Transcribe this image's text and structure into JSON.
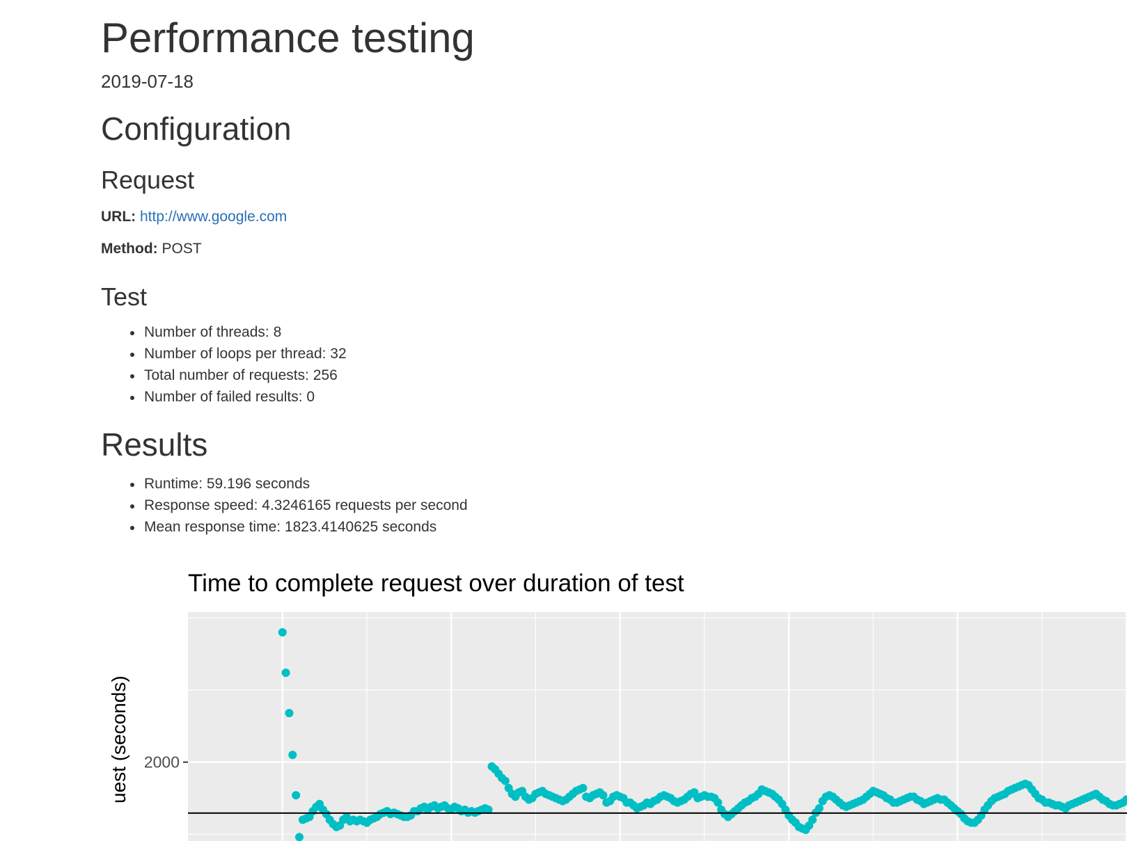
{
  "title": "Performance testing",
  "date": "2019-07-18",
  "configuration": {
    "heading": "Configuration",
    "request": {
      "heading": "Request",
      "url_label": "URL:",
      "url_value": "http://www.google.com",
      "method_label": "Method:",
      "method_value": "POST"
    },
    "test": {
      "heading": "Test",
      "items": [
        "Number of threads: 8",
        "Number of loops per thread: 32",
        "Total number of requests: 256",
        "Number of failed results: 0"
      ]
    }
  },
  "results": {
    "heading": "Results",
    "items": [
      "Runtime: 59.196 seconds",
      "Response speed: 4.3246165 requests per second",
      "Mean response time: 1823.4140625 seconds"
    ]
  },
  "chart_data": {
    "type": "scatter",
    "title": "Time to complete request over duration of test",
    "ylabel": "uest (seconds)",
    "xlabel": "",
    "y_ticks": [
      2000
    ],
    "x": [
      0,
      1,
      2,
      3,
      4,
      5,
      6,
      7,
      8,
      9,
      10,
      11,
      12,
      13,
      14,
      15,
      16,
      17,
      18,
      19,
      20,
      21,
      22,
      23,
      24,
      25,
      26,
      27,
      28,
      29,
      30,
      31,
      32,
      33,
      34,
      35,
      36,
      37,
      38,
      39,
      40,
      41,
      42,
      43,
      44,
      45,
      46,
      47,
      48,
      49,
      50,
      51,
      52,
      53,
      54,
      55,
      56,
      57,
      58,
      59,
      60,
      61,
      62,
      63,
      64,
      65,
      66,
      67,
      68,
      69,
      70,
      71,
      72,
      73,
      74,
      75,
      76,
      77,
      78,
      79,
      80,
      81,
      82,
      83,
      84,
      85,
      86,
      87,
      88,
      89,
      90,
      91,
      92,
      93,
      94,
      95,
      96,
      97,
      98,
      99,
      100,
      101,
      102,
      103,
      104,
      105,
      106,
      107,
      108,
      109,
      110,
      111,
      112,
      113,
      114,
      115,
      116,
      117,
      118,
      119,
      120,
      121,
      122,
      123,
      124,
      125,
      126,
      127,
      128,
      129,
      130,
      131,
      132,
      133,
      134,
      135,
      136,
      137,
      138,
      139,
      140,
      141,
      142,
      143,
      144,
      145,
      146,
      147,
      148,
      149,
      150,
      151,
      152,
      153,
      154,
      155,
      156,
      157,
      158,
      159,
      160,
      161,
      162,
      163,
      164,
      165,
      166,
      167,
      168,
      169,
      170,
      171,
      172,
      173,
      174,
      175,
      176,
      177,
      178,
      179,
      180,
      181,
      182,
      183,
      184,
      185,
      186,
      187,
      188,
      189,
      190,
      191,
      192,
      193,
      194,
      195,
      196,
      197,
      198,
      199,
      200,
      201,
      202,
      203,
      204,
      205,
      206,
      207,
      208,
      209,
      210,
      211,
      212,
      213,
      214,
      215,
      216,
      217,
      218,
      219,
      220,
      221,
      222,
      223,
      224,
      225,
      226,
      227,
      228,
      229,
      230,
      231,
      232,
      233,
      234,
      235,
      236,
      237,
      238,
      239,
      240,
      241,
      242,
      243,
      244,
      245,
      246,
      247,
      248,
      249,
      250,
      251,
      252,
      253,
      254,
      255
    ],
    "y": [
      2450,
      2310,
      2170,
      2025,
      1885,
      1740,
      1800,
      1805,
      1810,
      1830,
      1845,
      1855,
      1835,
      1820,
      1800,
      1785,
      1775,
      1780,
      1800,
      1810,
      1795,
      1800,
      1795,
      1800,
      1795,
      1790,
      1800,
      1805,
      1810,
      1820,
      1825,
      1830,
      1820,
      1825,
      1820,
      1815,
      1810,
      1810,
      1815,
      1830,
      1830,
      1840,
      1845,
      1835,
      1845,
      1850,
      1840,
      1845,
      1850,
      1840,
      1835,
      1845,
      1840,
      1830,
      1835,
      1825,
      1830,
      1825,
      1830,
      1835,
      1840,
      1835,
      1985,
      1975,
      1960,
      1945,
      1935,
      1910,
      1890,
      1880,
      1895,
      1900,
      1880,
      1870,
      1875,
      1890,
      1895,
      1900,
      1890,
      1885,
      1880,
      1875,
      1870,
      1865,
      1870,
      1880,
      1890,
      1900,
      1905,
      1910,
      1880,
      1875,
      1885,
      1890,
      1895,
      1885,
      1860,
      1865,
      1880,
      1885,
      1880,
      1875,
      1860,
      1860,
      1850,
      1840,
      1845,
      1850,
      1860,
      1855,
      1865,
      1870,
      1880,
      1885,
      1880,
      1875,
      1865,
      1860,
      1865,
      1870,
      1880,
      1890,
      1895,
      1875,
      1880,
      1885,
      1880,
      1880,
      1875,
      1860,
      1835,
      1820,
      1810,
      1820,
      1830,
      1840,
      1850,
      1860,
      1865,
      1875,
      1880,
      1890,
      1905,
      1900,
      1895,
      1890,
      1880,
      1870,
      1855,
      1835,
      1815,
      1800,
      1790,
      1775,
      1770,
      1765,
      1780,
      1800,
      1825,
      1840,
      1865,
      1880,
      1885,
      1880,
      1870,
      1860,
      1850,
      1845,
      1850,
      1855,
      1860,
      1865,
      1870,
      1880,
      1890,
      1900,
      1895,
      1890,
      1885,
      1875,
      1870,
      1860,
      1860,
      1865,
      1870,
      1875,
      1880,
      1880,
      1870,
      1865,
      1855,
      1860,
      1865,
      1870,
      1875,
      1870,
      1870,
      1860,
      1850,
      1840,
      1830,
      1820,
      1805,
      1795,
      1790,
      1790,
      1800,
      1815,
      1835,
      1850,
      1865,
      1875,
      1880,
      1885,
      1890,
      1900,
      1905,
      1910,
      1915,
      1920,
      1925,
      1920,
      1905,
      1890,
      1875,
      1870,
      1860,
      1860,
      1855,
      1850,
      1850,
      1845,
      1840,
      1850,
      1855,
      1860,
      1865,
      1870,
      1875,
      1880,
      1885,
      1890,
      1880,
      1870,
      1865,
      1855,
      1850,
      1850,
      1855,
      1860,
      1870,
      1875,
      1880,
      1880
    ],
    "mean": 1823.4140625,
    "ylim": [
      1700,
      2520
    ],
    "xlim": [
      -28,
      271
    ],
    "grid": true,
    "colors": {
      "points": "#00BFC4",
      "panel": "#EBEBEB",
      "grid": "#FFFFFF",
      "mean_line": "#000000"
    }
  }
}
